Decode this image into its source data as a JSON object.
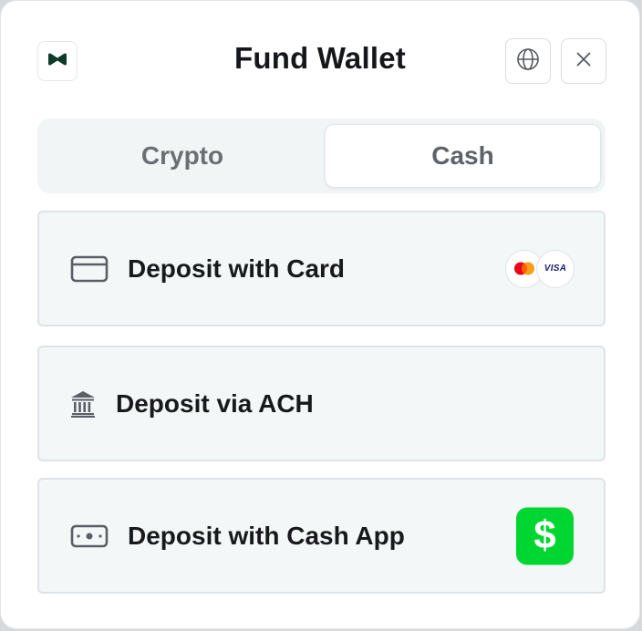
{
  "header": {
    "title": "Fund Wallet",
    "logo_icon": "brand-logo-icon",
    "globe_icon": "globe-icon",
    "close_icon": "close-icon"
  },
  "tabs": [
    {
      "label": "Crypto",
      "active": false
    },
    {
      "label": "Cash",
      "active": true
    }
  ],
  "options": [
    {
      "label": "Deposit with Card",
      "icon": "credit-card-icon",
      "badges": [
        "mastercard",
        "VISA"
      ]
    },
    {
      "label": "Deposit via ACH",
      "icon": "bank-icon"
    },
    {
      "label": "Deposit with Cash App",
      "icon": "cash-icon",
      "badge": "$"
    }
  ],
  "colors": {
    "accent": "#5b7fd6",
    "cashapp_green": "#00d632",
    "option_bg": "#f4f7f8"
  }
}
